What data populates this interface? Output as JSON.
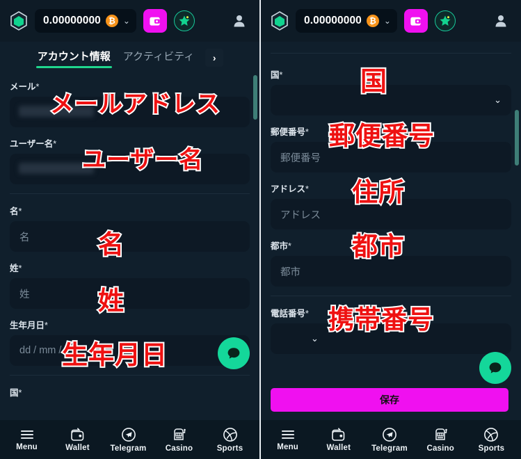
{
  "topbar": {
    "balance": "0.00000000",
    "currency_icon": "bitcoin-icon",
    "logo_icon": "hexagon-logo-icon",
    "dropdown_icon": "chevron-down-icon",
    "wallet_icon": "wallet-icon",
    "gift_icon": "star-gift-icon",
    "avatar_icon": "user-avatar-icon",
    "wallet_color": "#f010f0",
    "bitcoin_color": "#f7931a"
  },
  "tabs": {
    "items": [
      {
        "label": "アカウント情報",
        "active": true
      },
      {
        "label": "アクティビティ",
        "active": false
      }
    ],
    "next_label": "›",
    "active_underline_color": "#1fd68d"
  },
  "left_form": {
    "fields": [
      {
        "label": "メール",
        "required": "*",
        "placeholder": "",
        "redacted": true,
        "annotation": "メールアドレス"
      },
      {
        "label": "ユーザー名",
        "required": "*",
        "placeholder": "",
        "redacted": true,
        "annotation": "ユーザー名"
      },
      {
        "label": "名",
        "required": "*",
        "placeholder": "名",
        "redacted": false,
        "annotation": "名"
      },
      {
        "label": "姓",
        "required": "*",
        "placeholder": "姓",
        "redacted": false,
        "annotation": "姓"
      },
      {
        "label": "生年月日",
        "required": "*",
        "placeholder": "dd / mm /",
        "redacted": false,
        "annotation": "生年月日"
      },
      {
        "label": "国",
        "required": "*",
        "placeholder": "",
        "redacted": false,
        "annotation": ""
      }
    ]
  },
  "right_form": {
    "fields": [
      {
        "label": "国",
        "required": "*",
        "placeholder": "",
        "type": "select",
        "annotation": "国"
      },
      {
        "label": "郵便番号",
        "required": "*",
        "placeholder": "郵便番号",
        "type": "text",
        "annotation": "郵便番号"
      },
      {
        "label": "アドレス",
        "required": "*",
        "placeholder": "アドレス",
        "type": "text",
        "annotation": "住所"
      },
      {
        "label": "都市",
        "required": "*",
        "placeholder": "都市",
        "type": "text",
        "annotation": "都市"
      },
      {
        "label": "電話番号",
        "required": "*",
        "placeholder": "",
        "type": "phone",
        "annotation": "携帯番号"
      }
    ],
    "save_label": "保存",
    "save_color": "#f010f0"
  },
  "chat": {
    "icon": "chat-bubble-icon",
    "color": "#14d79a"
  },
  "bottomnav": {
    "items": [
      {
        "label": "Menu",
        "icon": "hamburger-menu-icon"
      },
      {
        "label": "Wallet",
        "icon": "wallet-icon"
      },
      {
        "label": "Telegram",
        "icon": "telegram-icon"
      },
      {
        "label": "Casino",
        "icon": "slot-machine-icon"
      },
      {
        "label": "Sports",
        "icon": "ball-icon"
      }
    ]
  }
}
